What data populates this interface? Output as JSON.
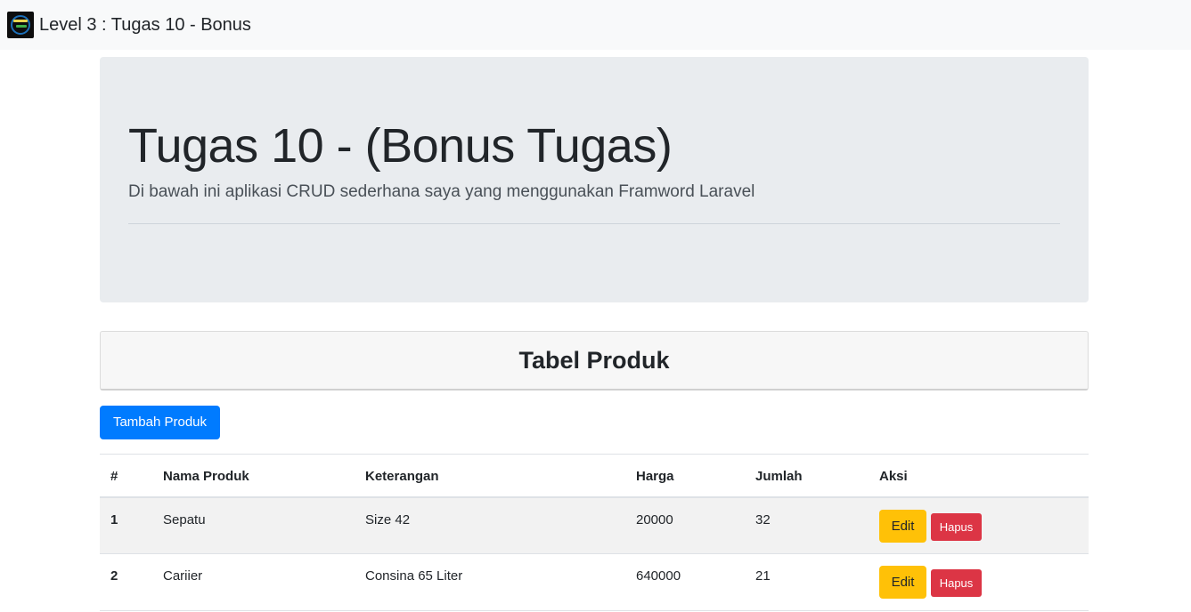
{
  "navbar": {
    "brand_title": "Level 3 : Tugas 10 - Bonus",
    "logo_icon": "app-logo-icon"
  },
  "jumbotron": {
    "title": "Tugas 10 - (Bonus Tugas)",
    "lead": "Di bawah ini aplikasi CRUD sederhana saya yang menggunakan Framword Laravel"
  },
  "card": {
    "title": "Tabel Produk"
  },
  "actions": {
    "add_label": "Tambah Produk"
  },
  "table": {
    "headers": [
      "#",
      "Nama Produk",
      "Keterangan",
      "Harga",
      "Jumlah",
      "Aksi"
    ],
    "rows": [
      {
        "no": "1",
        "nama": "Sepatu",
        "keterangan": "Size 42",
        "harga": "20000",
        "jumlah": "32",
        "edit_label": "Edit",
        "hapus_label": "Hapus"
      },
      {
        "no": "2",
        "nama": "Cariier",
        "keterangan": "Consina 65 Liter",
        "harga": "640000",
        "jumlah": "21",
        "edit_label": "Edit",
        "hapus_label": "Hapus"
      }
    ]
  },
  "colors": {
    "primary": "#007bff",
    "warning": "#ffc107",
    "danger": "#dc3545",
    "jumbotron_bg": "#e9ecef",
    "navbar_bg": "#f8f9fa"
  }
}
